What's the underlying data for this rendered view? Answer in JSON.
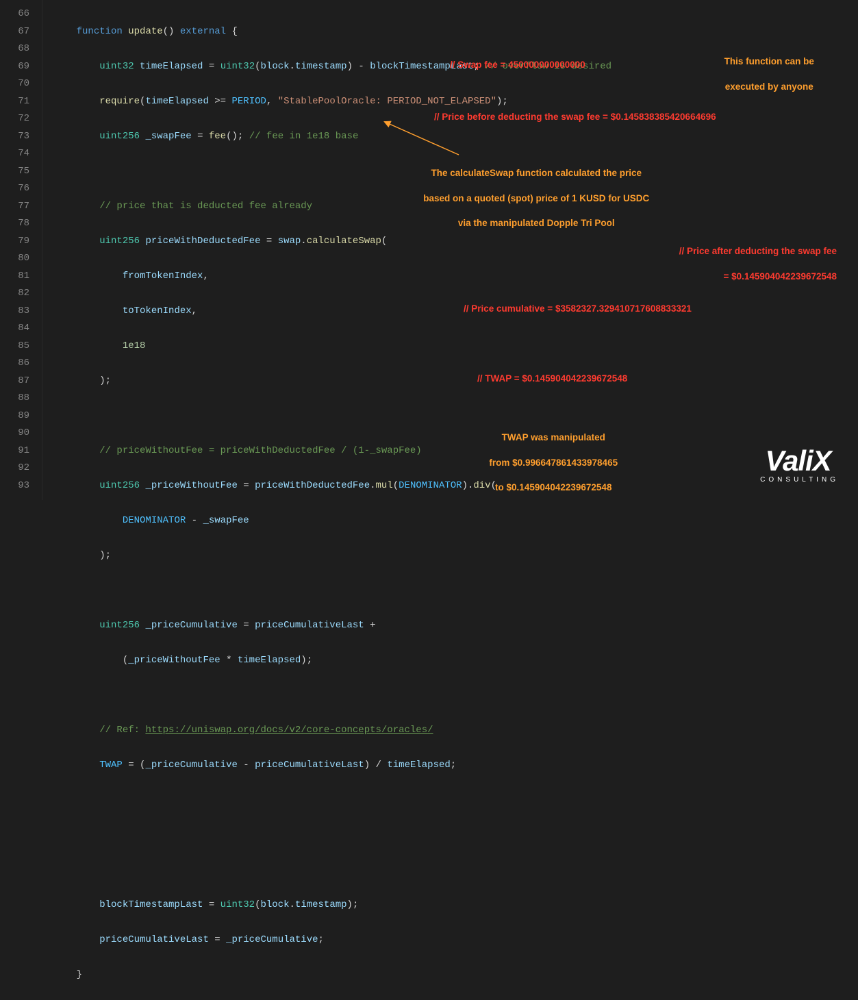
{
  "lineNumbers": [
    "66",
    "67",
    "68",
    "69",
    "70",
    "71",
    "72",
    "73",
    "74",
    "75",
    "76",
    "77",
    "78",
    "79",
    "80",
    "81",
    "82",
    "83",
    "84",
    "85",
    "86",
    "87",
    "88",
    "89",
    "90",
    "91",
    "92",
    "93"
  ],
  "code": {
    "l66": {
      "function": "function",
      "update": "update",
      "external": "external",
      "brace": "{"
    },
    "l67": {
      "type": "uint32",
      "var": "timeElapsed",
      "eq": "=",
      "cast": "uint32",
      "block": "block",
      "ts": "timestamp",
      "minus": "-",
      "last": "blockTimestampLast",
      "semi": ";",
      "comment": "// overflow is desired"
    },
    "l68": {
      "require": "require",
      "open": "(",
      "a": "timeElapsed",
      "op": ">=",
      "b": "PERIOD",
      "comma": ",",
      "str": "\"StablePoolOracle: PERIOD_NOT_ELAPSED\"",
      "close": ");"
    },
    "l69": {
      "type": "uint256",
      "var": "_swapFee",
      "eq": "=",
      "fn": "fee",
      "call": "();",
      "comment": "// fee in 1e18 base"
    },
    "l71": {
      "comment": "// price that is deducted fee already"
    },
    "l72": {
      "type": "uint256",
      "var": "priceWithDeductedFee",
      "eq": "=",
      "obj": "swap",
      "dot": ".",
      "fn": "calculateSwap",
      "open": "("
    },
    "l73": {
      "arg": "fromTokenIndex",
      "comma": ","
    },
    "l74": {
      "arg": "toTokenIndex",
      "comma": ","
    },
    "l75": {
      "arg": "1e18"
    },
    "l76": {
      "close": ");"
    },
    "l78": {
      "comment": "// priceWithoutFee = priceWithDeductedFee / (1-_swapFee)"
    },
    "l79": {
      "type": "uint256",
      "var": "_priceWithoutFee",
      "eq": "=",
      "a": "priceWithDeductedFee",
      "dot": ".",
      "mul": "mul",
      "open": "(",
      "denom": "DENOMINATOR",
      "close": ")",
      "dot2": ".",
      "div": "div",
      "open2": "("
    },
    "l80": {
      "denom": "DENOMINATOR",
      "minus": "-",
      "b": "_swapFee"
    },
    "l81": {
      "close": ");"
    },
    "l83": {
      "type": "uint256",
      "var": "_priceCumulative",
      "eq": "=",
      "a": "priceCumulativeLast",
      "plus": "+"
    },
    "l84": {
      "open": "(",
      "a": "_priceWithoutFee",
      "mul": "*",
      "b": "timeElapsed",
      "close": ");"
    },
    "l86": {
      "comment": "// Ref: ",
      "url": "https://uniswap.org/docs/v2/core-concepts/oracles/"
    },
    "l87": {
      "twap": "TWAP",
      "eq": "=",
      "open": "(",
      "a": "_priceCumulative",
      "minus": "-",
      "b": "priceCumulativeLast",
      "close": ")",
      "div": "/",
      "c": "timeElapsed",
      "semi": ";"
    },
    "l91": {
      "a": "blockTimestampLast",
      "eq": "=",
      "cast": "uint32",
      "open": "(",
      "block": "block",
      "dot": ".",
      "ts": "timestamp",
      "close": ");"
    },
    "l92": {
      "a": "priceCumulativeLast",
      "eq": "=",
      "b": "_priceCumulative",
      "semi": ";"
    },
    "l93": {
      "brace": "}"
    }
  },
  "annotations": {
    "swapFee": "// Swap fee = 450000000000000",
    "anyoneL1": "This function can be",
    "anyoneL2": "executed by anyone",
    "priceBefore": "// Price before deducting the swap fee = $0.145838385420664696",
    "calcSwapL1": "The calculateSwap function calculated the price",
    "calcSwapL2": "based on a quoted (spot) price of 1 KUSD for USDC",
    "calcSwapL3": "via the manipulated Dopple Tri Pool",
    "priceAfterL1": "// Price after deducting the swap fee",
    "priceAfterL2": "= $0.145904042239672548",
    "priceCum": "// Price cumulative = $3582327.329410717608833321",
    "twap": "// TWAP = $0.145904042239672548",
    "manipL1": "TWAP was manipulated",
    "manipL2": "from $0.996647861433978465",
    "manipL3": "to $0.145904042239672548"
  },
  "logo": {
    "name": "ValiX",
    "sub": "CONSULTING"
  }
}
